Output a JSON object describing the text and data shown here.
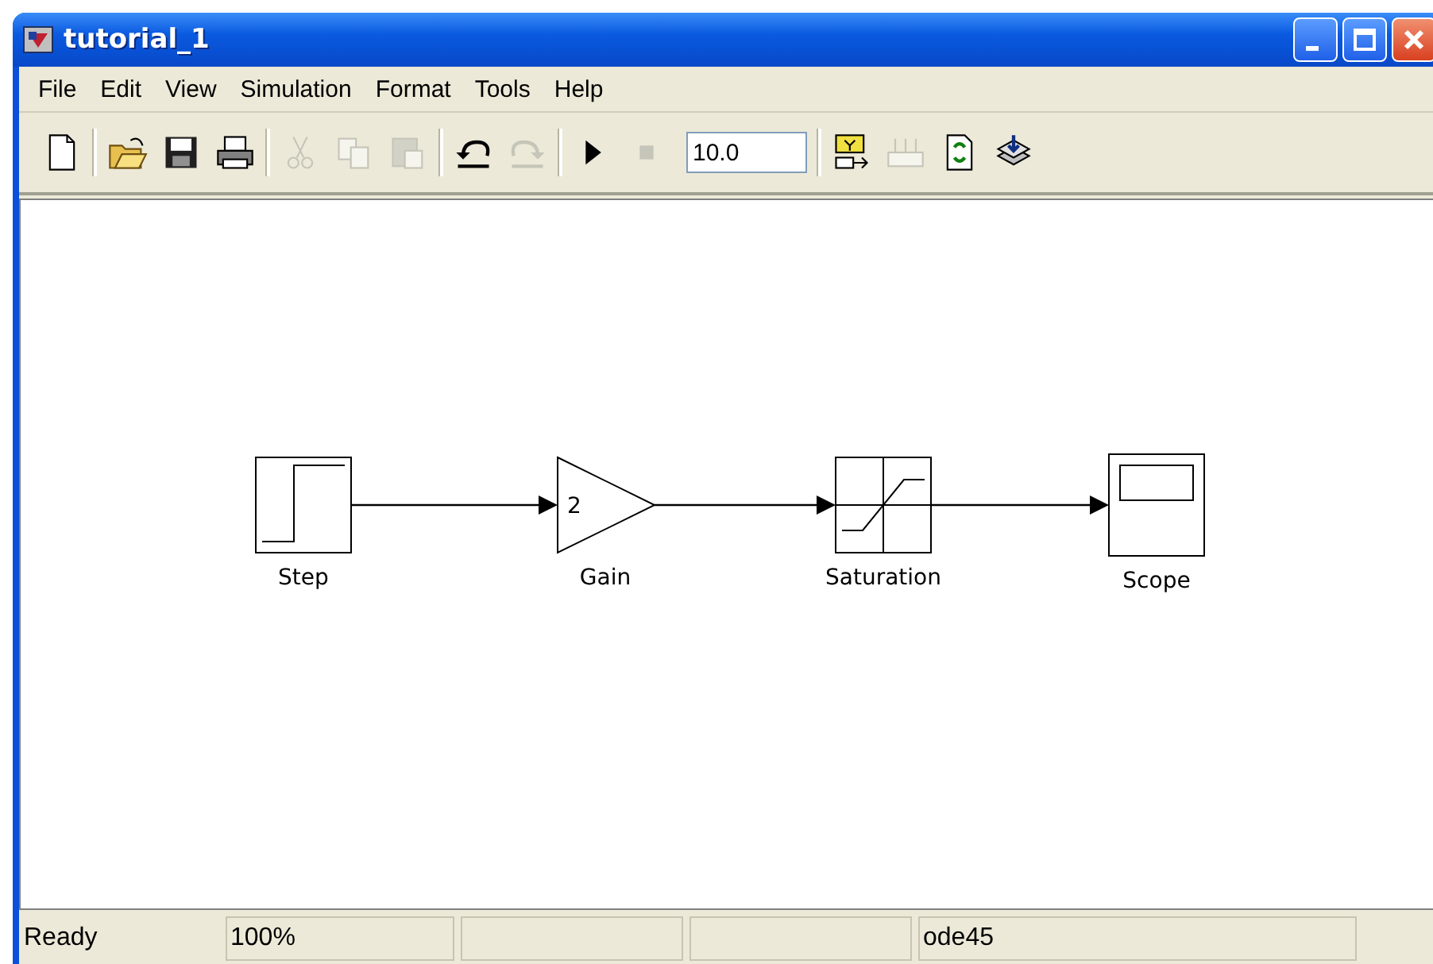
{
  "window": {
    "title": "tutorial_1"
  },
  "menu": [
    "File",
    "Edit",
    "View",
    "Simulation",
    "Format",
    "Tools",
    "Help"
  ],
  "toolbar": [
    [
      {
        "kind": "new",
        "disabled": false
      }
    ],
    [
      {
        "kind": "open",
        "disabled": false
      },
      {
        "kind": "save",
        "disabled": false
      },
      {
        "kind": "print",
        "disabled": false
      }
    ],
    [
      {
        "kind": "cut",
        "disabled": true
      },
      {
        "kind": "copy",
        "disabled": true
      },
      {
        "kind": "paste",
        "disabled": true
      }
    ],
    [
      {
        "kind": "undo",
        "disabled": false
      },
      {
        "kind": "redo",
        "disabled": true
      }
    ],
    [
      {
        "kind": "start",
        "disabled": false
      },
      {
        "kind": "stop",
        "disabled": true
      },
      {
        "kind": "field",
        "value": "10.0"
      }
    ],
    [
      {
        "kind": "browser",
        "disabled": false
      },
      {
        "kind": "library",
        "disabled": true
      },
      {
        "kind": "update",
        "disabled": false
      },
      {
        "kind": "build",
        "disabled": false
      }
    ]
  ],
  "blocks": [
    {
      "kind": "step",
      "label": "Step"
    },
    {
      "kind": "gain",
      "label": "Gain",
      "value": "2"
    },
    {
      "kind": "saturation",
      "label": "Saturation"
    },
    {
      "kind": "scope",
      "label": "Scope"
    }
  ],
  "status_bar": [
    {
      "text": "Ready"
    },
    {
      "text": "100%"
    },
    {
      "text": "ode45"
    }
  ]
}
